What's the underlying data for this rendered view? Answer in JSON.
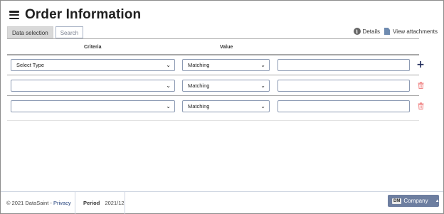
{
  "header": {
    "title": "Order Information"
  },
  "tabs": [
    {
      "label": "Data selection",
      "active": true
    },
    {
      "label": "Search",
      "active": false
    }
  ],
  "links": {
    "details": "Details",
    "attachments": "View attachments"
  },
  "table": {
    "columns": {
      "criteria": "Criteria",
      "value": "Value"
    },
    "rows": [
      {
        "criteria": "Select Type",
        "value": "Matching",
        "input": "",
        "action": "add"
      },
      {
        "criteria": "",
        "value": "Matching",
        "input": "",
        "action": "delete"
      },
      {
        "criteria": "",
        "value": "Matching",
        "input": "",
        "action": "delete"
      }
    ]
  },
  "footer": {
    "copyright": "© 2021 DataSaint - ",
    "privacy": "Privacy",
    "period_label": "Period",
    "period_value": "2021/12",
    "company_badge": "DM",
    "company_label": "Company"
  },
  "colors": {
    "accent": "#1f2a5a",
    "delete": "#f08a8a",
    "company_button": "#6d7ea0"
  },
  "icons": {
    "menu": "hamburger-icon",
    "info": "info-icon",
    "file": "file-icon",
    "add": "plus-icon",
    "delete": "trash-icon"
  }
}
